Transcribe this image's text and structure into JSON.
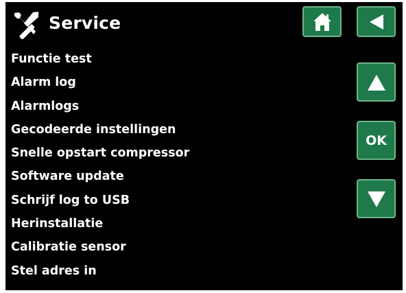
{
  "header": {
    "title": "Service",
    "title_icon": "tools-icon"
  },
  "menu": {
    "items": [
      "Functie test",
      "Alarm log",
      "Alarmlogs",
      "Gecodeerde instellingen",
      "Snelle opstart compressor",
      "Software update",
      "Schrijf log to USB",
      "Herinstallatie",
      "Calibratie sensor",
      "Stel adres in"
    ]
  },
  "controls": {
    "home_icon": "home-icon",
    "back_icon": "back-arrow-icon",
    "up_icon": "arrow-up-icon",
    "ok_label": "OK",
    "down_icon": "arrow-down-icon"
  },
  "colors": {
    "background": "#000000",
    "text": "#ffffff",
    "button_fill": "#1f7a4b",
    "button_border": "#6fb58c"
  }
}
